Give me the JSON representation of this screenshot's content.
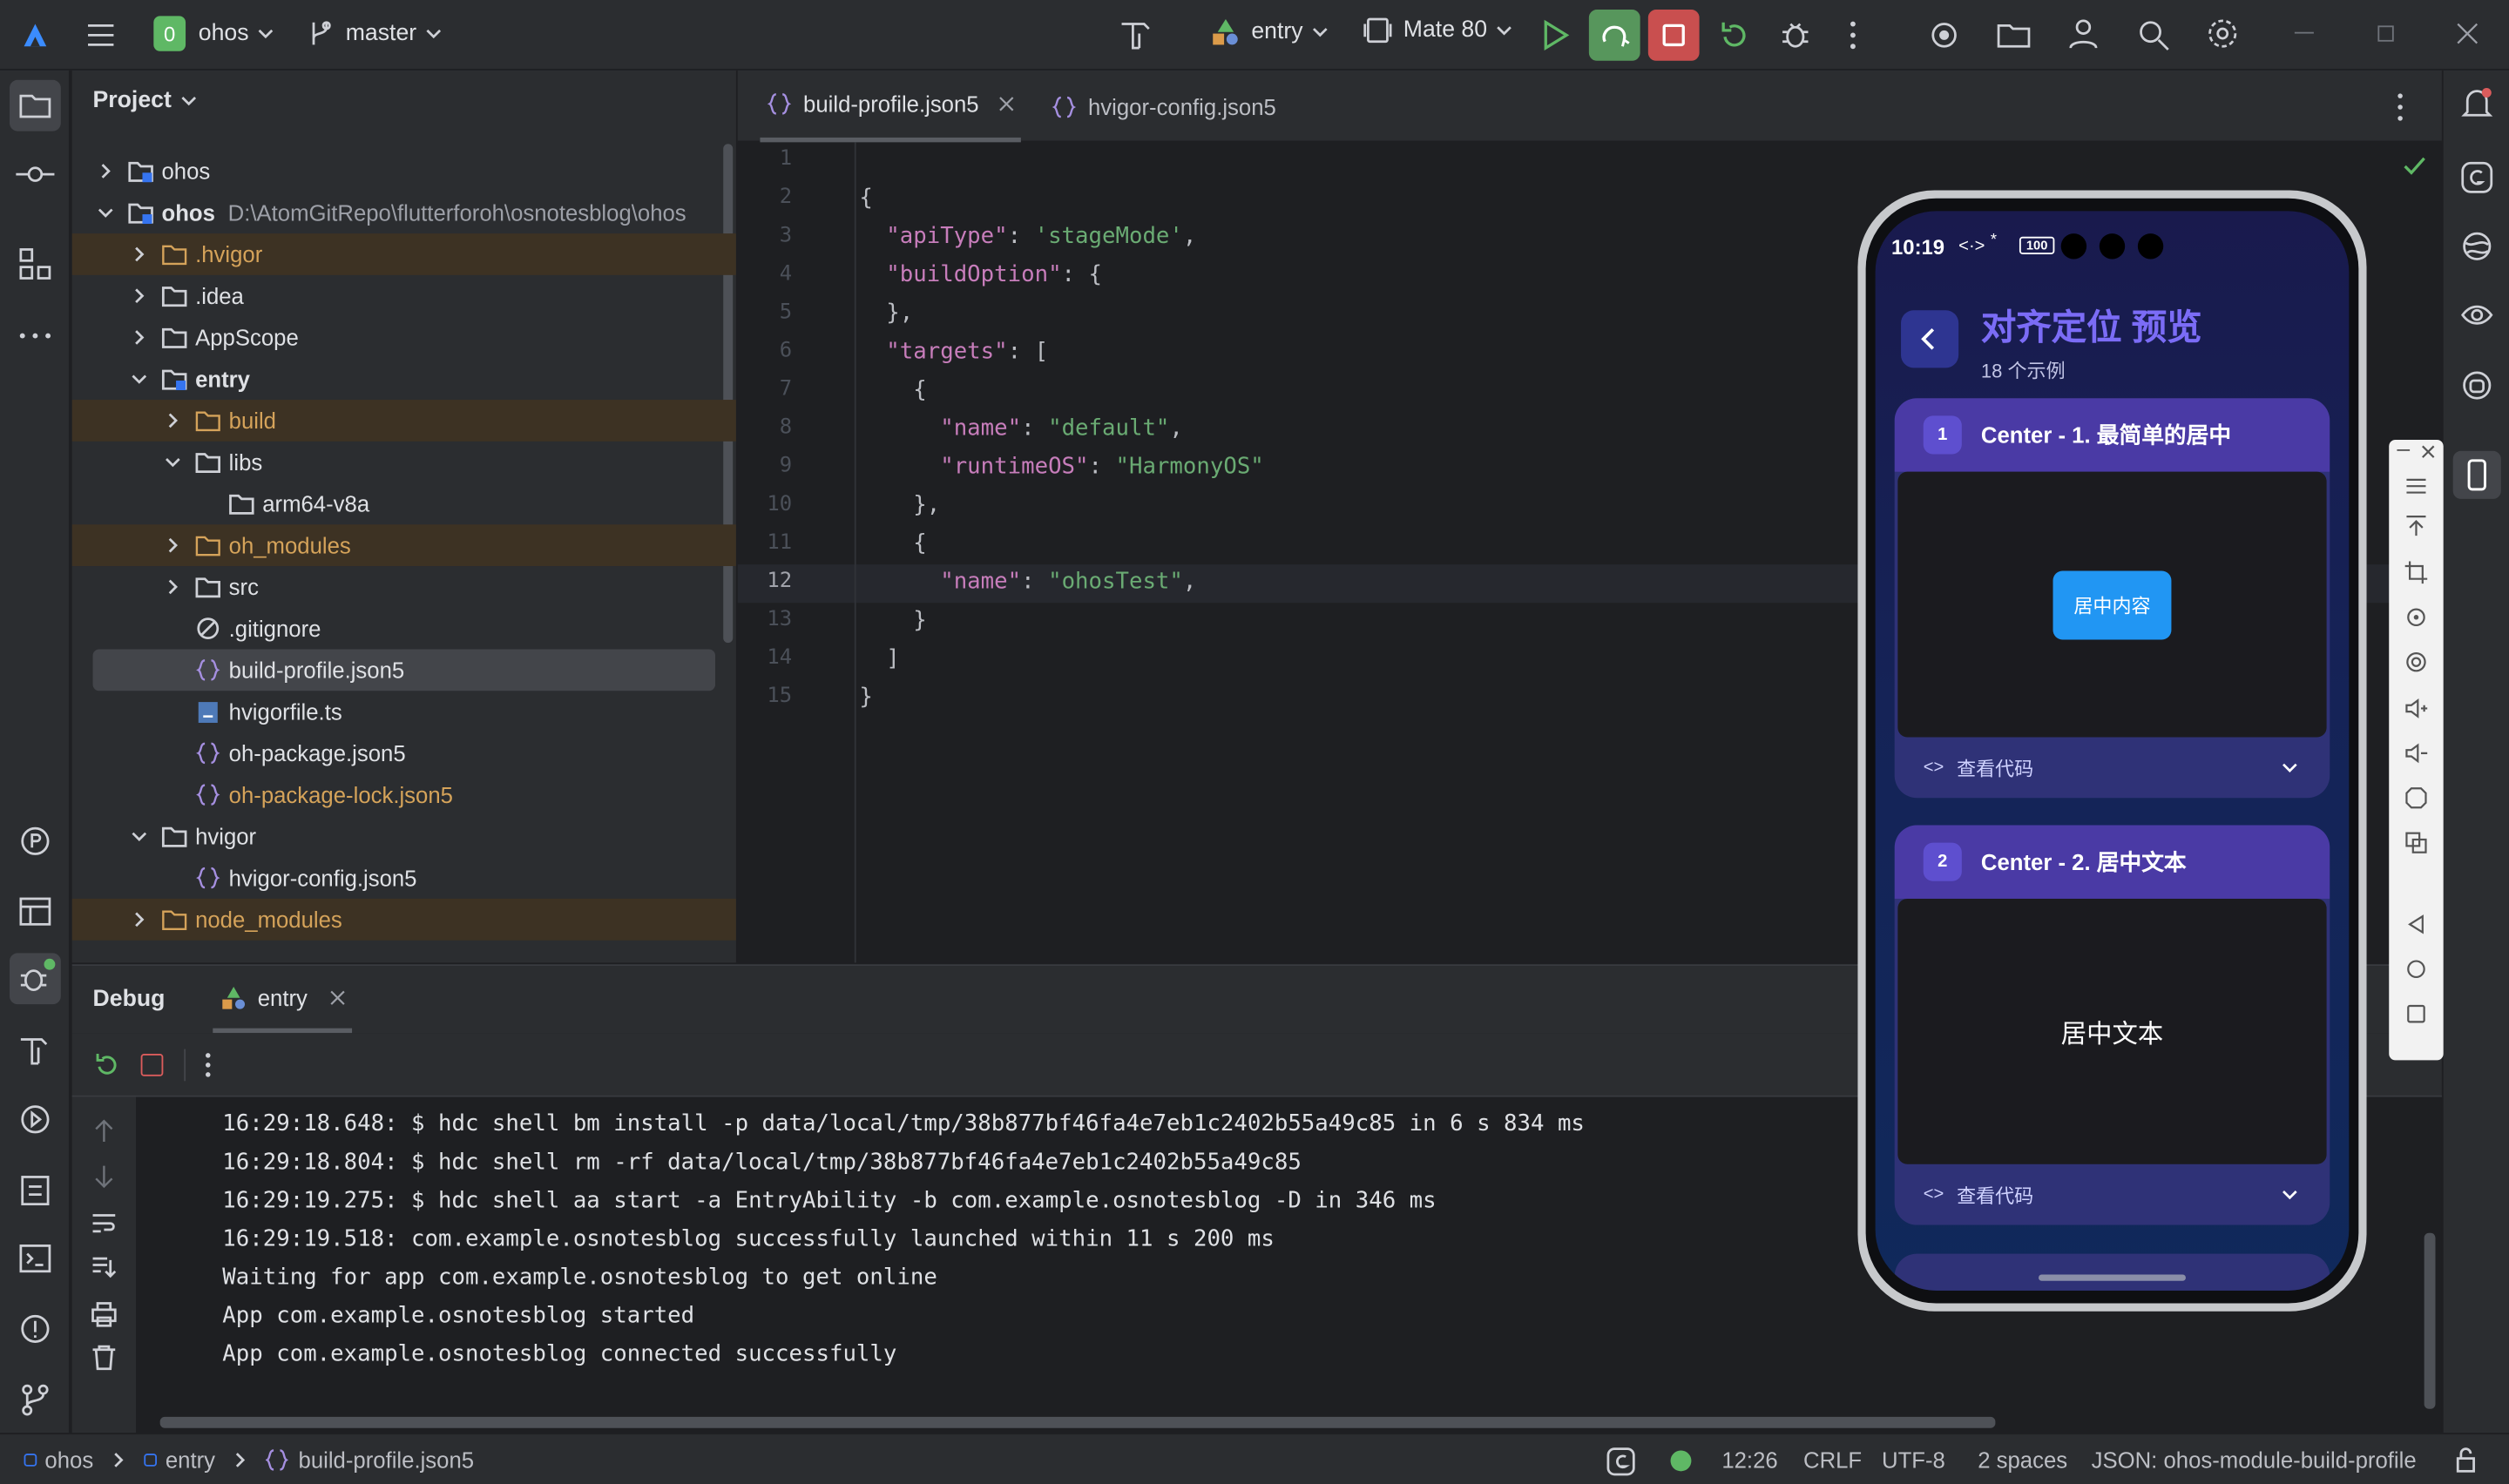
{
  "titlebar": {
    "project_badge": "0",
    "project_name": "ohos",
    "branch": "master",
    "run_config": "entry",
    "device": "Mate 80"
  },
  "project_panel": {
    "title": "Project",
    "rows": [
      {
        "label": "ohos",
        "path": ""
      },
      {
        "label": "ohos",
        "path": "D:\\AtomGitRepo\\flutterforoh\\osnotesblog\\ohos"
      },
      {
        "label": ".hvigor"
      },
      {
        "label": ".idea"
      },
      {
        "label": "AppScope"
      },
      {
        "label": "entry"
      },
      {
        "label": "build"
      },
      {
        "label": "libs"
      },
      {
        "label": "arm64-v8a"
      },
      {
        "label": "oh_modules"
      },
      {
        "label": "src"
      },
      {
        "label": ".gitignore"
      },
      {
        "label": "build-profile.json5"
      },
      {
        "label": "hvigorfile.ts"
      },
      {
        "label": "oh-package.json5"
      },
      {
        "label": "oh-package-lock.json5"
      },
      {
        "label": "hvigor"
      },
      {
        "label": "hvigor-config.json5"
      },
      {
        "label": "node_modules"
      }
    ]
  },
  "editor": {
    "tabs": [
      {
        "label": "build-profile.json5"
      },
      {
        "label": "hvigor-config.json5"
      }
    ],
    "line_numbers": [
      "1",
      "2",
      "3",
      "4",
      "5",
      "6",
      "7",
      "8",
      "9",
      "10",
      "11",
      "12",
      "13",
      "14",
      "15"
    ]
  },
  "debug": {
    "title": "Debug",
    "tab": "entry",
    "log": [
      "16:29:18.648: $ hdc shell bm install -p data/local/tmp/38b877bf46fa4e7eb1c2402b55a49c85 in 6 s 834 ms",
      "16:29:18.804: $ hdc shell rm -rf data/local/tmp/38b877bf46fa4e7eb1c2402b55a49c85",
      "16:29:19.275: $ hdc shell aa start -a EntryAbility -b com.example.osnotesblog -D in 346 ms",
      "16:29:19.518: com.example.osnotesblog successfully launched within 11 s 200 ms",
      "Waiting for app com.example.osnotesblog to get online",
      "App com.example.osnotesblog started",
      "App com.example.osnotesblog connected successfully"
    ]
  },
  "statusbar": {
    "crumbs": [
      "ohos",
      "entry",
      "build-profile.json5"
    ],
    "position": "12:26",
    "line_sep": "CRLF",
    "encoding": "UTF-8",
    "indent": "2 spaces",
    "schema": "JSON: ohos-module-build-profile"
  },
  "phone": {
    "time": "10:19",
    "battery": "100",
    "title": "对齐定位 预览",
    "subtitle": "18 个示例",
    "cards": [
      {
        "num": "1",
        "title": "Center - 1. 最简单的居中",
        "demo_text": "居中内容",
        "code_label": "查看代码"
      },
      {
        "num": "2",
        "title": "Center - 2. 居中文本",
        "demo_text": "居中文本",
        "code_label": "查看代码"
      }
    ]
  },
  "colors": {
    "accent_orange": "#d5a35a",
    "run_green": "#5fb865",
    "stop_red": "#db5c5c",
    "phone_title": "#7b6cf6"
  }
}
